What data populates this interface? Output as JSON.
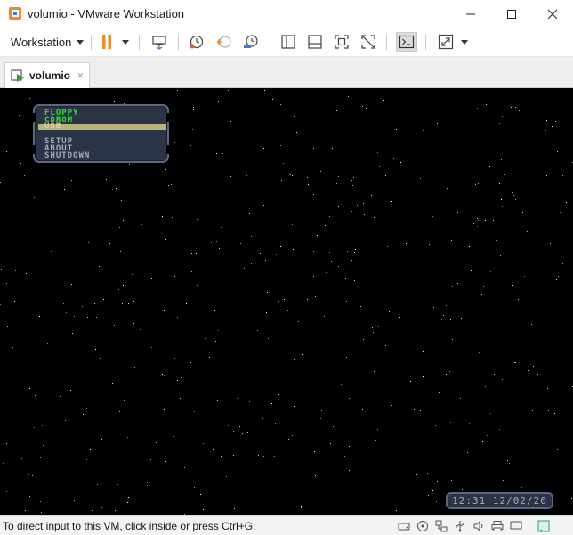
{
  "window": {
    "title": "volumio - VMware Workstation",
    "accent_color": "#f08a24"
  },
  "toolbar": {
    "workstation_menu": "Workstation",
    "icons": [
      "pause-icon",
      "send-ctrl-alt-del-icon",
      "snapshot-icon",
      "revert-snapshot-icon",
      "snapshot-manager-icon",
      "thumbnail-bar-icon",
      "library-icon",
      "full-screen-icon",
      "unity-icon",
      "console-view-icon",
      "stretch-icon"
    ]
  },
  "tab": {
    "label": "volumio",
    "close": "×"
  },
  "vm": {
    "boot_menu": [
      {
        "label": "FLOPPY",
        "state": "normal"
      },
      {
        "label": "CDROM",
        "state": "normal"
      },
      {
        "label": "USB",
        "state": "selected"
      },
      {
        "label": "SETUP",
        "state": "normal"
      },
      {
        "label": "ABOUT",
        "state": "normal"
      },
      {
        "label": "SHUTDOWN",
        "state": "normal"
      }
    ],
    "clock": "12:31 12/02/20"
  },
  "statusbar": {
    "message": "To direct input to this VM, click inside or press Ctrl+G.",
    "icons": [
      "hard-disk-icon",
      "cd-icon",
      "network-icon",
      "usb-icon",
      "sound-icon",
      "printer-icon",
      "display-icon",
      "message-icon"
    ]
  }
}
